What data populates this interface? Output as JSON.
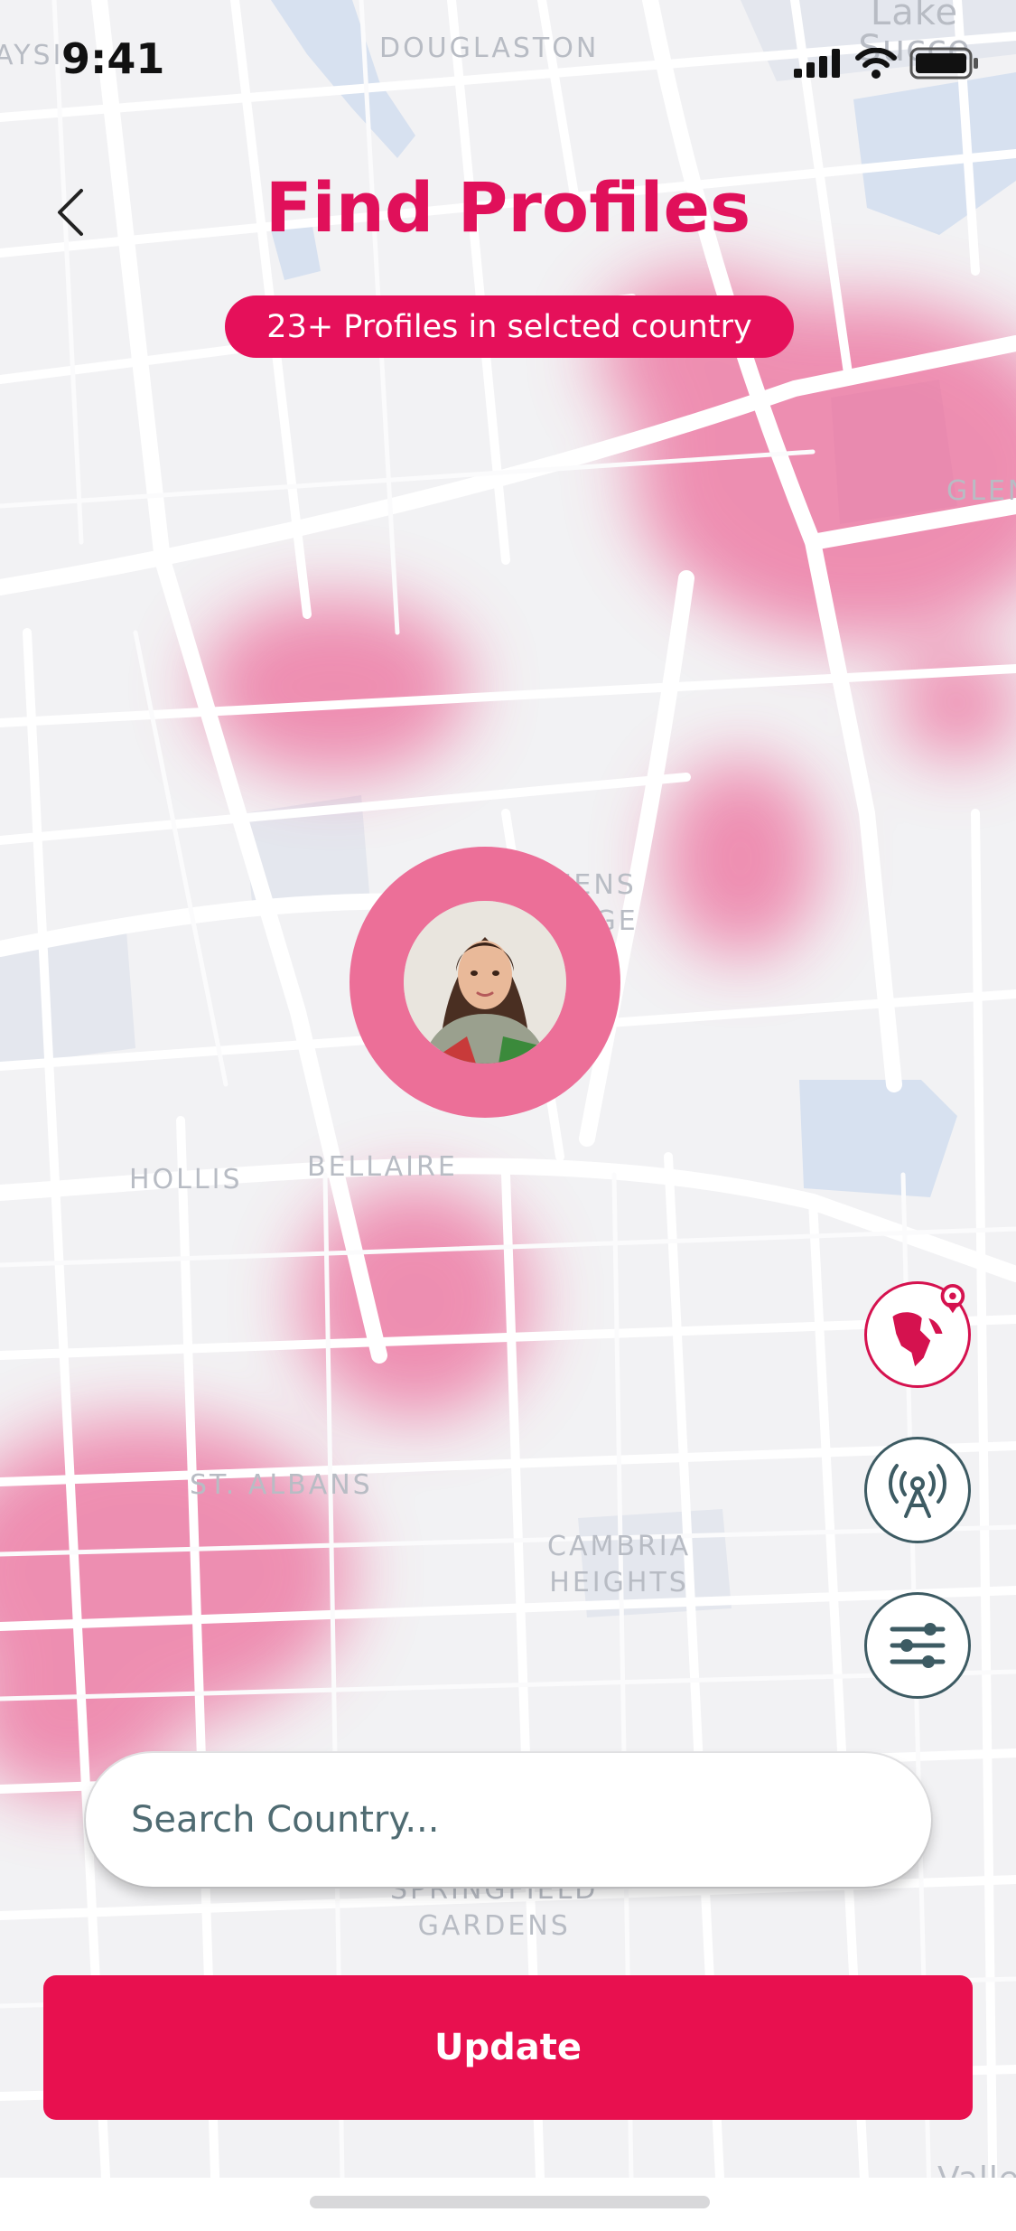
{
  "status_bar": {
    "time": "9:41"
  },
  "header": {
    "back_icon": "chevron-left-icon",
    "title": "Find Profiles",
    "badge": "23+ Profiles  in selcted country"
  },
  "map": {
    "labels": [
      {
        "name": "douglaston",
        "text": "DOUGLASTON"
      },
      {
        "name": "queens-village",
        "text": "QUEENS\nVILLAGE"
      },
      {
        "name": "hollis",
        "text": "HOLLIS"
      },
      {
        "name": "bellaire",
        "text": "BELLAIRE"
      },
      {
        "name": "st-albans",
        "text": "ST. ALBANS"
      },
      {
        "name": "cambria-heights",
        "text": "CAMBRIA\nHEIGHTS"
      },
      {
        "name": "springfield-gardens",
        "text": "SPRINGFIELD\nGARDENS"
      },
      {
        "name": "glen",
        "text": "GLEN"
      },
      {
        "name": "lake-success",
        "text": "Lake Succe"
      },
      {
        "name": "aysi",
        "text": "AYSI"
      },
      {
        "name": "valle",
        "text": "Valle"
      }
    ],
    "heat_color": "#ec5f92"
  },
  "actions": {
    "globe_icon": "globe-pin-icon",
    "broadcast_icon": "antenna-icon",
    "filter_icon": "sliders-icon"
  },
  "search": {
    "placeholder": "Search Country..."
  },
  "update_button": {
    "label": "Update"
  },
  "colors": {
    "accent": "#e8104f",
    "title": "#e0105a",
    "icon_teal": "#3d5b63"
  }
}
